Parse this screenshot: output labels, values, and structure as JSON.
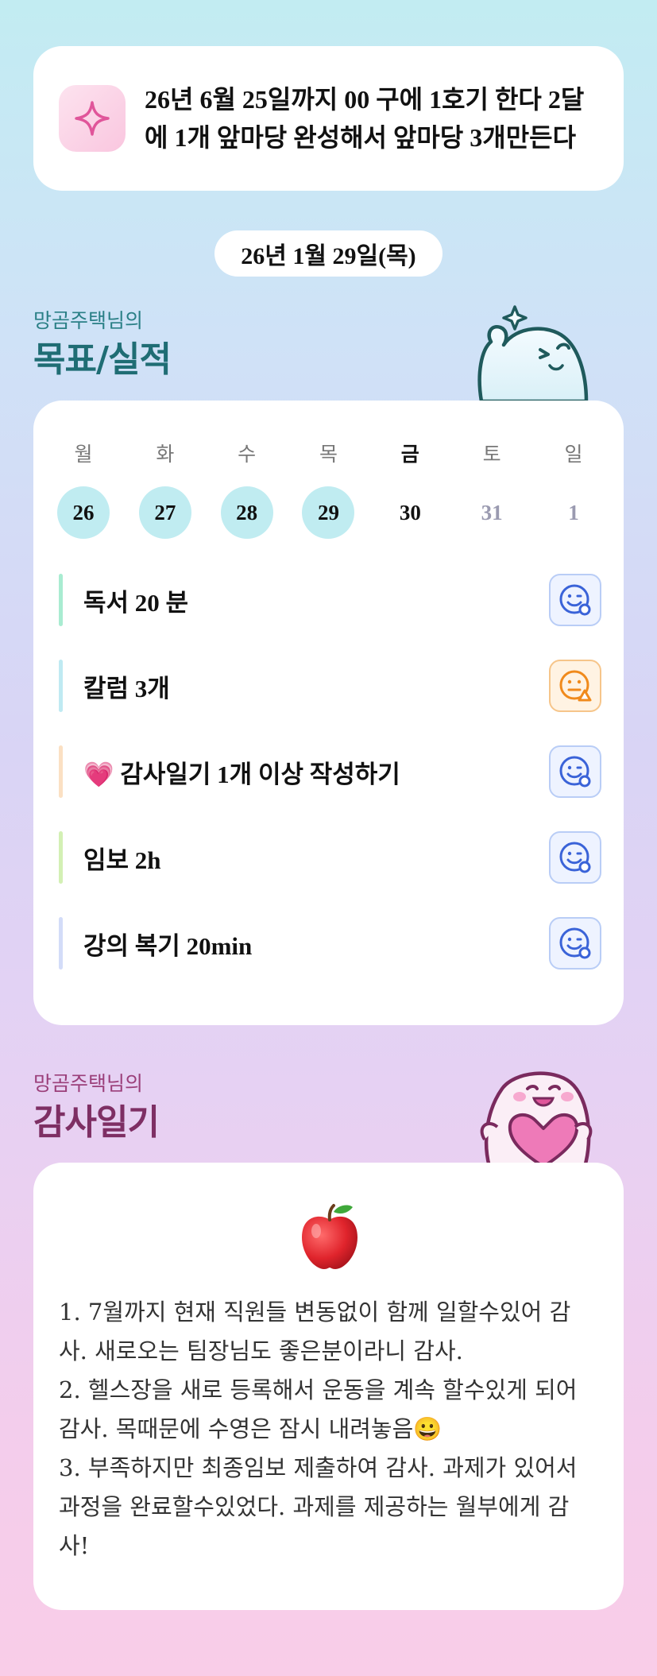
{
  "goal": {
    "text": "26년 6월 25일까지 00 구에 1호기 한다 2달에 1개 앞마당 완성해서 앞마당 3개만든다",
    "icon": "sparkle-icon"
  },
  "date_label": "26년 1월 29일(목)",
  "goals_section": {
    "subtitle": "망곰주택님의",
    "title": "목표/실적"
  },
  "calendar": {
    "weekdays": [
      "월",
      "화",
      "수",
      "목",
      "금",
      "토",
      "일"
    ],
    "days": [
      "26",
      "27",
      "28",
      "29",
      "30",
      "31",
      "1"
    ]
  },
  "tasks": [
    {
      "label": "독서 20 분",
      "status": "happy-face-icon",
      "accent": "#a9ecd1"
    },
    {
      "label": "칼럼 3개",
      "status": "neutral-face-warning-icon",
      "accent": "#bfeaf2"
    },
    {
      "label": "💗 감사일기 1개 이상 작성하기",
      "status": "happy-face-icon",
      "accent": "#fbe0c3"
    },
    {
      "label": "임보 2h",
      "status": "happy-face-icon",
      "accent": "#d3f0b4"
    },
    {
      "label": "강의 복기 20min",
      "status": "happy-face-icon",
      "accent": "#d3dcf8"
    }
  ],
  "journal_section": {
    "subtitle": "망곰주택님의",
    "title": "감사일기"
  },
  "journal": {
    "icon": "apple-icon",
    "text": "1. 7월까지 현재 직원들 변동없이 함께 일할수있어 감사. 새로오는 팀장님도 좋은분이라니 감사.\n2. 헬스장을 새로 등록해서 운동을 계속 할수있게 되어 감사. 목때문에 수영은 잠시 내려놓음😀\n3. 부족하지만 최종임보 제출하여 감사. 과제가 있어서  과정을 완료할수있었다. 과제를 제공하는 월부에게 감사!"
  },
  "colors": {
    "done_day": "#c0ecf1",
    "happy_btn_bg": "#eef3ff",
    "happy_btn_border": "#b9cdf6",
    "happy_icon": "#3a63d8",
    "warn_btn_bg": "#fff3e3",
    "warn_btn_border": "#f6c58a",
    "warn_icon": "#f08a1c"
  }
}
